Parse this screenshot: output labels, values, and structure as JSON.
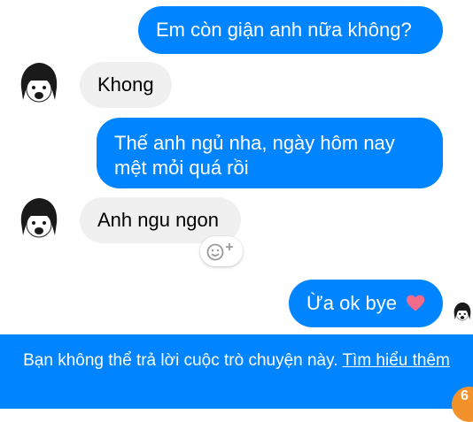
{
  "messages": [
    {
      "text": "Em còn giận anh nữa không?"
    },
    {
      "text": "Khong"
    },
    {
      "text": "Thế anh ngủ nha, ngày hôm nay mệt mỏi quá rồi"
    },
    {
      "text": "Anh ngu ngon"
    },
    {
      "text": "Ừa ok bye"
    }
  ],
  "banner": {
    "text": "Bạn không thể trả lời cuộc trò chuyện này.",
    "link": "Tìm hiểu thêm"
  },
  "icons": {
    "reaction": "add-reaction-icon",
    "heart": "heart-icon",
    "avatar": "contact-avatar"
  },
  "colors": {
    "outgoing_bubble": "#0084ff",
    "incoming_bubble": "#f1f0f0",
    "banner": "#0084ff",
    "heart": "#f26b8a"
  }
}
